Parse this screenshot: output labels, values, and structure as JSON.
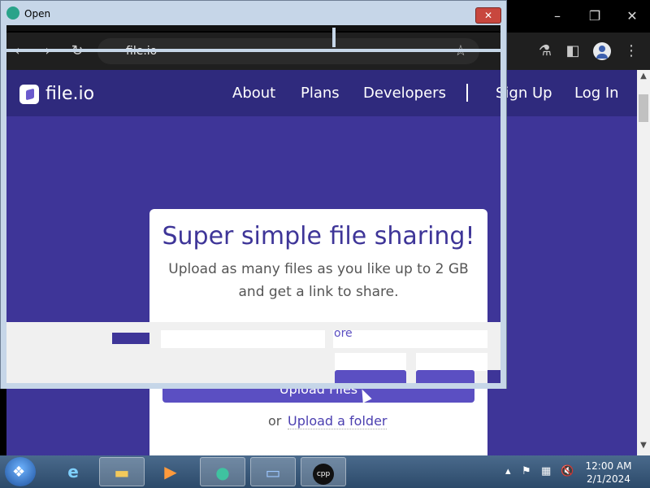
{
  "browser": {
    "url": "file.io",
    "window_controls": [
      "–",
      "❐",
      "✕"
    ]
  },
  "site": {
    "logo": "file.io",
    "nav": {
      "about": "About",
      "plans": "Plans",
      "developers": "Developers",
      "signup": "Sign Up",
      "login": "Log In"
    },
    "card": {
      "title": "Super simple file sharing!",
      "subtitle_line1": "Upload as many files as you like up to 2 GB",
      "subtitle_line2": "and get a link to share.",
      "upload_button": "Upload Files",
      "or": "or",
      "folder_link": "Upload a folder"
    }
  },
  "dialog": {
    "title": "Open",
    "close_glyph": "✕",
    "partial_text": "ore"
  },
  "taskbar": {
    "time": "12:00 AM",
    "date": "2/1/2024",
    "cpp_label": "cpp"
  },
  "colors": {
    "brand_purple": "#3e3598",
    "nav_purple": "#2f2a7d",
    "button_purple": "#5b4fc2"
  }
}
